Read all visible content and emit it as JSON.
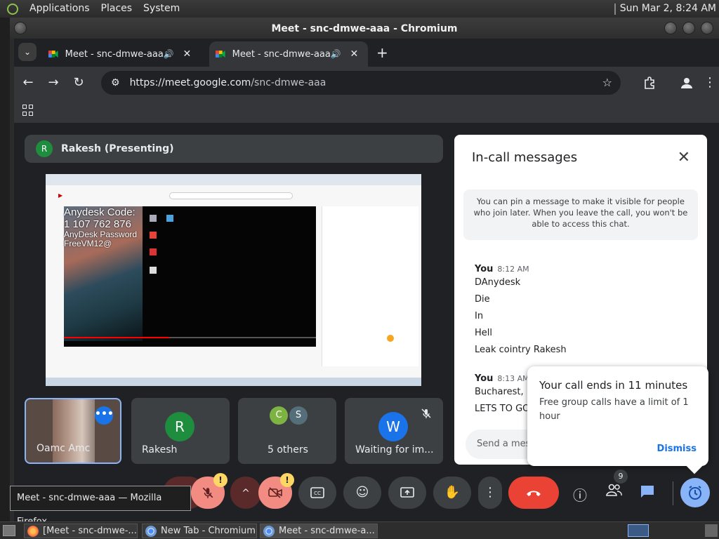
{
  "top_panel": {
    "menus": [
      "Applications",
      "Places",
      "System"
    ],
    "clock": "Sun Mar  2,  8:24 AM"
  },
  "window": {
    "title": "Meet - snc-dmwe-aaa - Chromium"
  },
  "tabs": [
    {
      "title": "Meet - snc-dmwe-aaa",
      "audio": "🔊",
      "close": "✕"
    },
    {
      "title": "Meet - snc-dmwe-aaa",
      "audio": "🔊",
      "close": "✕"
    }
  ],
  "toolbar": {
    "url_host": "https://meet.google.com",
    "url_path": "/snc-dmwe-aaa"
  },
  "presentation": {
    "presenter_initial": "R",
    "presenter_label": "Rakesh (Presenting)",
    "shared_screen": {
      "code_line1": "Anydesk Code:",
      "code_line2": "1 107 762 876",
      "pass_line1": "AnyDesk Password",
      "pass_line2": "FreeVM12@"
    }
  },
  "tiles": {
    "self_name": "Oamc Amc",
    "self_more": "•••",
    "rakesh_initial": "R",
    "rakesh_name": "Rakesh",
    "others_initial1": "C",
    "others_initial2": "S",
    "others_label": "5 others",
    "waiting_initial": "W",
    "waiting_label": "Waiting for im..."
  },
  "chat": {
    "title": "In-call messages",
    "notice": "You can pin a message to make it visible for people who join later. When you leave the call, you won't be able to access this chat.",
    "groups": [
      {
        "sender": "You",
        "time": "8:12 AM",
        "lines": [
          "DAnydesk",
          "Die",
          "In",
          "Hell",
          "Leak cointry Rakesh"
        ]
      },
      {
        "sender": "You",
        "time": "8:13 AM",
        "lines": [
          "Bucharest, R...",
          "LETS TO GO ..."
        ]
      }
    ],
    "input_placeholder": "Send a mess..."
  },
  "toast": {
    "title": "Your call ends in 11 minutes",
    "body": "Free group calls have a limit of 1 hour",
    "dismiss": "Dismiss"
  },
  "controls": {
    "warn": "!",
    "people_count": "9"
  },
  "tooltip": {
    "text": "Meet - snc-dmwe-aaa — Mozilla Firefox"
  },
  "taskbar": {
    "items": [
      "[Meet - snc-dmwe-...",
      "New Tab - Chromium",
      "Meet - snc-dmwe-a..."
    ]
  },
  "colors": {
    "meet_bg": "#202124",
    "accent_blue": "#8ab4f8",
    "end_call_red": "#ea4335",
    "warning_yellow": "#fdd663"
  }
}
